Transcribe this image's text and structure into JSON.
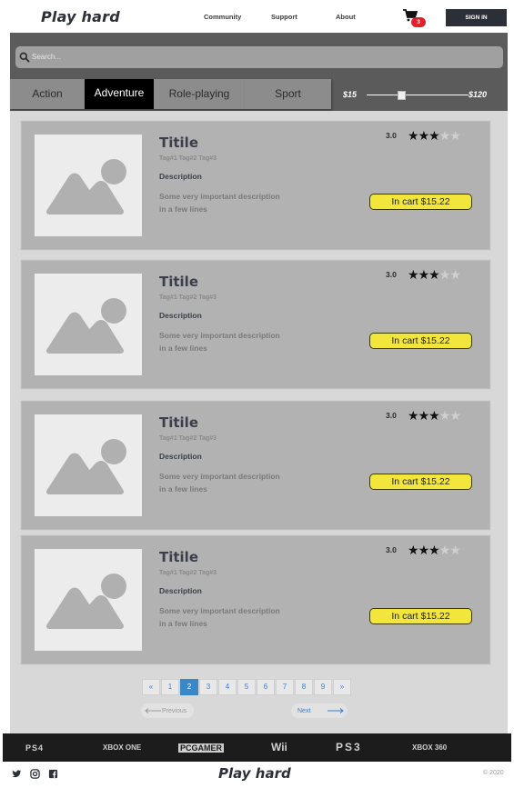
{
  "header": {
    "logo": "Play hard",
    "nav": [
      "Community",
      "Support",
      "About"
    ],
    "cart_count": "3",
    "signin_label": "SIGN IN"
  },
  "search": {
    "placeholder": "Search..."
  },
  "filters": {
    "tabs": [
      "Action",
      "Adventure",
      "Role-playing",
      "Sport"
    ],
    "active_tab": "Adventure",
    "price_min": "$15",
    "price_max": "$120",
    "slider_value_fraction": 0.3
  },
  "products": [
    {
      "title": "Titile",
      "tags": "Tag#1 Tag#2 Tag#3",
      "desc_label": "Description",
      "desc_line1": "Some very important description",
      "desc_line2": "in a few lines",
      "rating": "3.0",
      "stars": 3,
      "cart_label": "In cart $15.22"
    },
    {
      "title": "Titile",
      "tags": "Tag#1 Tag#2 Tag#3",
      "desc_label": "Description",
      "desc_line1": "Some very important description",
      "desc_line2": "in a few lines",
      "rating": "3.0",
      "stars": 3,
      "cart_label": "In cart $15.22"
    },
    {
      "title": "Titile",
      "tags": "Tag#1 Tag#2 Tag#3",
      "desc_label": "Description",
      "desc_line1": "Some very important description",
      "desc_line2": "in a few lines",
      "rating": "3.0",
      "stars": 3,
      "cart_label": "In cart $15.22"
    },
    {
      "title": "Titile",
      "tags": "Tag#1 Tag#2 Tag#3",
      "desc_label": "Description",
      "desc_line1": "Some very important description",
      "desc_line2": "in a few lines",
      "rating": "3.0",
      "stars": 3,
      "cart_label": "In cart $15.22"
    }
  ],
  "pagination": {
    "first": "«",
    "pages": [
      "1",
      "2",
      "3",
      "4",
      "5",
      "6",
      "7",
      "8",
      "9"
    ],
    "last": "»",
    "current": "2",
    "prev_label": "Previous",
    "next_label": "Next"
  },
  "platforms": [
    "PS4",
    "XBOX ONE",
    "PCGAMER",
    "Wii",
    "PS3",
    "XBOX 360"
  ],
  "footer": {
    "logo": "Play hard",
    "social_icons": [
      "twitter-icon",
      "instagram-icon",
      "facebook-icon"
    ],
    "copyright": "© 2020"
  },
  "colors": {
    "accent_yellow": "#f2e63c",
    "dark": "#2b2f38",
    "badge_red": "#e0202a",
    "page_active": "#3a87c8"
  }
}
